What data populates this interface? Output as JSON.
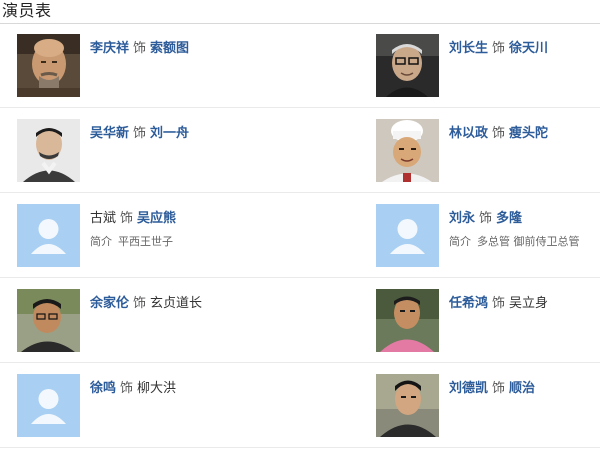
{
  "header": {
    "title": "演员表"
  },
  "cast": [
    {
      "actor": "李庆祥",
      "sep": "饰",
      "role": "索额图",
      "actor_link": true,
      "role_link": true,
      "intro_label": "",
      "intro": "",
      "photo": "bald-mustache-man"
    },
    {
      "actor": "刘长生",
      "sep": "饰",
      "role": "徐天川",
      "actor_link": true,
      "role_link": true,
      "intro_label": "",
      "intro": "",
      "photo": "glasses-old-man"
    },
    {
      "actor": "吴华新",
      "sep": "饰",
      "role": "刘一舟",
      "actor_link": true,
      "role_link": true,
      "intro_label": "",
      "intro": "",
      "photo": "young-man"
    },
    {
      "actor": "林以政",
      "sep": "饰",
      "role": "瘦头陀",
      "actor_link": true,
      "role_link": true,
      "intro_label": "",
      "intro": "",
      "photo": "chef-hat-man"
    },
    {
      "actor": "古斌",
      "sep": "饰",
      "role": "吴应熊",
      "actor_link": false,
      "role_link": true,
      "intro_label": "简介",
      "intro": "平西王世子",
      "photo": "default-avatar"
    },
    {
      "actor": "刘永",
      "sep": "饰",
      "role": "多隆",
      "actor_link": true,
      "role_link": true,
      "intro_label": "简介",
      "intro": "多总管 御前侍卫总管",
      "photo": "default-avatar"
    },
    {
      "actor": "余家伦",
      "sep": "饰",
      "role": "玄贞道长",
      "actor_link": true,
      "role_link": false,
      "intro_label": "",
      "intro": "",
      "photo": "middle-aged-man"
    },
    {
      "actor": "任希鸿",
      "sep": "饰",
      "role": "吴立身",
      "actor_link": true,
      "role_link": false,
      "intro_label": "",
      "intro": "",
      "photo": "pink-shirt-man"
    },
    {
      "actor": "徐鸣",
      "sep": "饰",
      "role": "柳大洪",
      "actor_link": true,
      "role_link": false,
      "intro_label": "",
      "intro": "",
      "photo": "default-avatar"
    },
    {
      "actor": "刘德凯",
      "sep": "饰",
      "role": "顺治",
      "actor_link": true,
      "role_link": true,
      "intro_label": "",
      "intro": "",
      "photo": "dark-jacket-man"
    }
  ]
}
